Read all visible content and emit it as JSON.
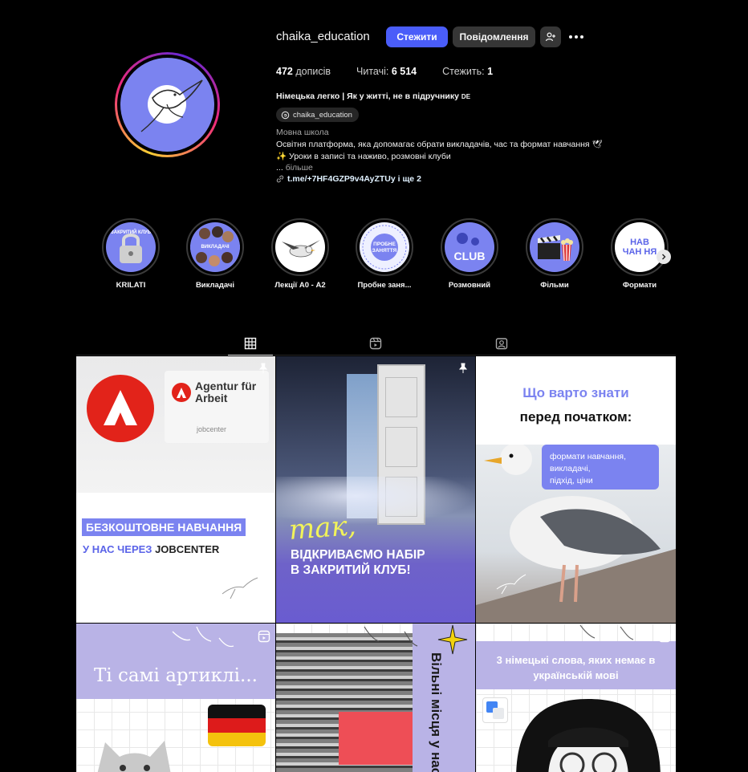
{
  "profile": {
    "username": "chaika_education",
    "follow_label": "Стежити",
    "message_label": "Повідомлення",
    "posts_count": "472",
    "posts_label": "дописів",
    "followers_label": "Читачі:",
    "followers_count": "6 514",
    "following_label": "Стежить:",
    "following_count": "1",
    "bio_name": "Німецька легко | Як у житті, не в підручнику",
    "bio_flag": "DE",
    "threads_handle": "chaika_education",
    "category": "Мовна школа",
    "bio_line1": "Освітня платформа, яка допомагає обрати викладачів, час та формат навчання",
    "bio_line2": "✨ Уроки в записі та наживо, розмовні клуби",
    "bio_ellipsis": "...",
    "bio_more": "більше",
    "link": "t.me/+7HF4GZP9v4AyZTUy і ще 2"
  },
  "highlights": [
    {
      "label": "KRILATI",
      "ring_text": "ЗАКРИТИЙ КЛУБ"
    },
    {
      "label": "Викладачі",
      "ring_text": "ВИКЛАДАЧІ"
    },
    {
      "label": "Лекції А0 - А2",
      "ring_text": ""
    },
    {
      "label": "Пробне заня...",
      "ring_text": "ПРОБНЕ ЗАНЯТТЯ"
    },
    {
      "label": "Розмовний",
      "ring_text": "CLUB"
    },
    {
      "label": "Фільми",
      "ring_text": ""
    },
    {
      "label": "Формати",
      "ring_text": "НАВ ЧАН НЯ"
    }
  ],
  "tabs": [
    "posts-tab",
    "reels-tab",
    "tagged-tab"
  ],
  "posts": {
    "p1": {
      "logo": "Agentur für Arbeit",
      "sub": "jobcenter",
      "banner": "БЕЗКОШТОВНЕ НАВЧАННЯ",
      "line_a": "У НАС ЧЕРЕЗ",
      "line_b": "JOBCENTER"
    },
    "p2": {
      "script": "так,",
      "title1": "ВІДКРИВАЄМО НАБІР",
      "title2": "В ЗАКРИТИЙ КЛУБ!"
    },
    "p3": {
      "title1": "Що варто знати",
      "title2": "перед початком:",
      "bubble1": "формати навчання,",
      "bubble2": "викладачі,",
      "bubble3": "підхід, ціни"
    },
    "p4": {
      "title": "Ті самі артиклі..."
    },
    "p5": {
      "title": "Вільні місця у нас"
    },
    "p6": {
      "title1": "3 німецькі слова, яких немає в",
      "title2": "українській мові"
    }
  },
  "colors": {
    "accent": "#4a5df9",
    "brand_lilac": "#7b83f0",
    "button_dark": "#363636"
  }
}
